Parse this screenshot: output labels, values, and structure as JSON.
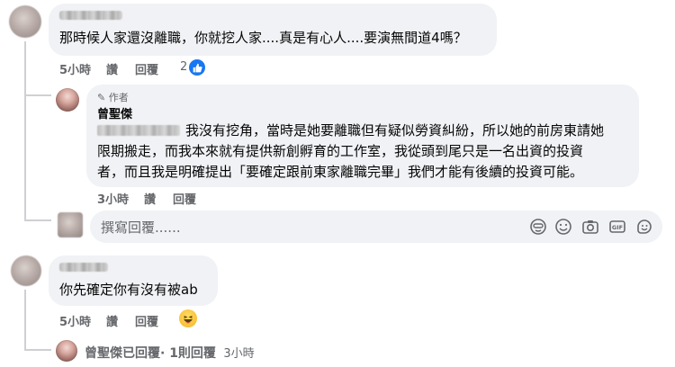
{
  "comment1": {
    "text": "那時候人家還沒離職，你就挖人家....真是有心人....要演無間道4嗎？",
    "time": "5小時",
    "like_label": "讚",
    "reply_label": "回覆",
    "reaction_count": "2"
  },
  "reply1": {
    "author_badge": "作者",
    "author_name": "曾聖傑",
    "text_line1": "我沒有挖角，當時是她要離職但有疑似勞資糾紛，所以她的前房東請她",
    "text_line2": "限期搬走，而我本來就有提供新創孵育的工作室，我從頭到尾只是一名出資的投資",
    "text_line3": "者，而且我是明確提出「要確定跟前東家離職完畢」我們才能有後續的投資可能。",
    "time": "3小時",
    "like_label": "讚",
    "reply_label": "回覆"
  },
  "reply_box": {
    "placeholder": "撰寫回覆......"
  },
  "comment2": {
    "text": "你先確定你有沒有被ab",
    "time": "5小時",
    "like_label": "讚",
    "reply_label": "回覆"
  },
  "replies_summary": {
    "text": "曾聖傑已回覆",
    "count": "· 1則回覆",
    "time": "3小時"
  },
  "colors": {
    "bubble": "#f0f2f5",
    "meta": "#65676b",
    "accent": "#1877f2",
    "haha": "#f7b125"
  }
}
